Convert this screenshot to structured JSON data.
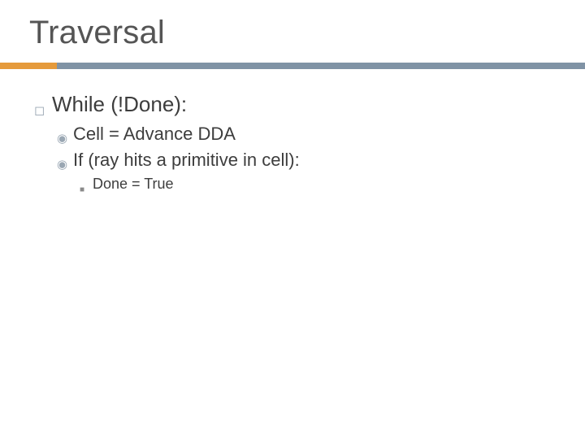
{
  "title": "Traversal",
  "bullets": {
    "l1": {
      "glyph": "◻",
      "text": "While (!Done):"
    },
    "l2a": {
      "glyph": "◉",
      "text": "Cell = Advance DDA"
    },
    "l2b": {
      "glyph": "◉",
      "text": "If (ray hits a primitive in cell):"
    },
    "l3": {
      "glyph": "■",
      "text": "Done = True"
    }
  },
  "colors": {
    "accent": "#e59a3b",
    "rule": "#8093a5"
  }
}
